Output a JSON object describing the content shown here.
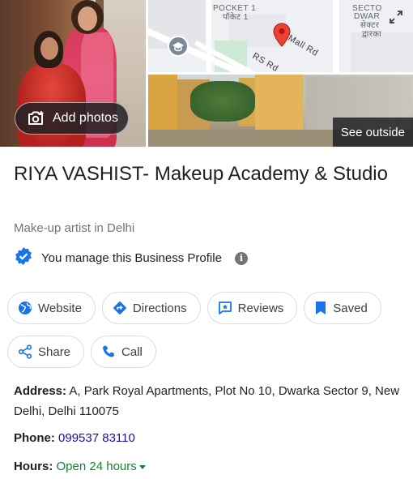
{
  "photos": {
    "add_photos_label": "Add photos",
    "see_outside_label": "See outside"
  },
  "map": {
    "labels": {
      "pocket": "POCKET 1",
      "pocket_hi": "पॉकेट 1",
      "sector": "SECTO",
      "dwarka": "DWAR",
      "sector_hi": "सेक्टर",
      "dwarka_hi": "द्वारका",
      "mall_rd": "Mall Rd",
      "rs_rd": "RS Rd"
    },
    "pin_color": "#ea4335"
  },
  "business": {
    "name": "RIYA VASHIST- Makeup Academy & Studio",
    "category": "Make-up artist in Delhi",
    "manage_text": "You manage this Business Profile",
    "verified_color": "#1a73e8"
  },
  "actions": {
    "website": "Website",
    "directions": "Directions",
    "reviews": "Reviews",
    "saved": "Saved",
    "share": "Share",
    "call": "Call",
    "accent": "#1a73e8"
  },
  "details": {
    "address_label": "Address:",
    "address_value": "A, Park Royal Apartments, Plot No 10, Dwarka Sector 9, New Delhi, Delhi 110075",
    "phone_label": "Phone:",
    "phone_value": "099537 83110",
    "hours_label": "Hours:",
    "hours_value": "Open 24 hours"
  }
}
